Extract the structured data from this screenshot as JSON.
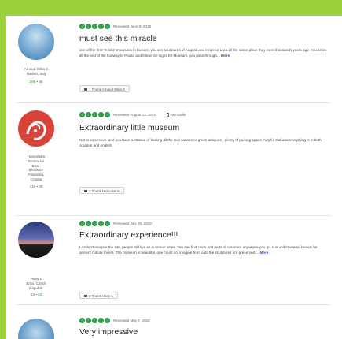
{
  "colors": {
    "accent": "#9bd13a",
    "bubble": "#34a853",
    "link": "#1a5bb0"
  },
  "reviews": [
    {
      "avatar": "avatar-photo-sky",
      "user_lines": [
        "Arnaud Wika S",
        "Treviso, Italy"
      ],
      "counts": "396 ▪ 45",
      "rating": 5,
      "date": "Reviewed June 8, 2019",
      "mobile": "",
      "title": "must see this miracle",
      "body": "one of the first \"in situ\" museums in Europe, you see sculptures of Augusti and emperor Livia all the same place they were thousands years ago. You arrive till the end of the footway to Poulia and follow the signs for Museum, you pass through...",
      "more": "More",
      "thank": "1  Thank Arnaud Wika S"
    },
    {
      "avatar": "avatar-photo-red",
      "user_lines": [
        "Humorist S",
        "Stomorski",
        "Brod,",
        "Brodsko-",
        "Posavska,",
        "Croatia"
      ],
      "counts": "215 ▪ 28",
      "rating": 5,
      "date": "Reviewed August 12, 2019",
      "mobile": "via mobile",
      "title": "Extraordinary little museum",
      "body": "Not to expensive, and you have a chance of looking all the real cannon or greek antiques . plenty of parking space, helpful staf and everything is in both croatian and english.",
      "more": "",
      "thank": "1  Thank Humorist S"
    },
    {
      "avatar": "avatar-photo-sunset",
      "user_lines": [
        "Hany L",
        "Brno, Czech",
        "Republic"
      ],
      "counts": "13 ▪ 24",
      "rating": 5,
      "date": "Reviewed July 29, 2019",
      "mobile": "",
      "title": "Extraordinary experience!!!",
      "body": "I couldn't imagine the site, people still live as in roman times. You can find coins and parts of ceramics anywhere you go. It is undiscovered beauty for ancient culture lovers. The museum is beautiful, one could not imagine from outil the sculptures are preserved....",
      "more": "More",
      "thank": "2  Thank Hany L"
    },
    {
      "avatar": "avatar-photo-sky",
      "user_lines": [],
      "counts": "",
      "rating": 5,
      "date": "Reviewed May 7, 2019",
      "mobile": "",
      "title": "Very impressive",
      "body": "",
      "more": "",
      "thank": ""
    }
  ]
}
